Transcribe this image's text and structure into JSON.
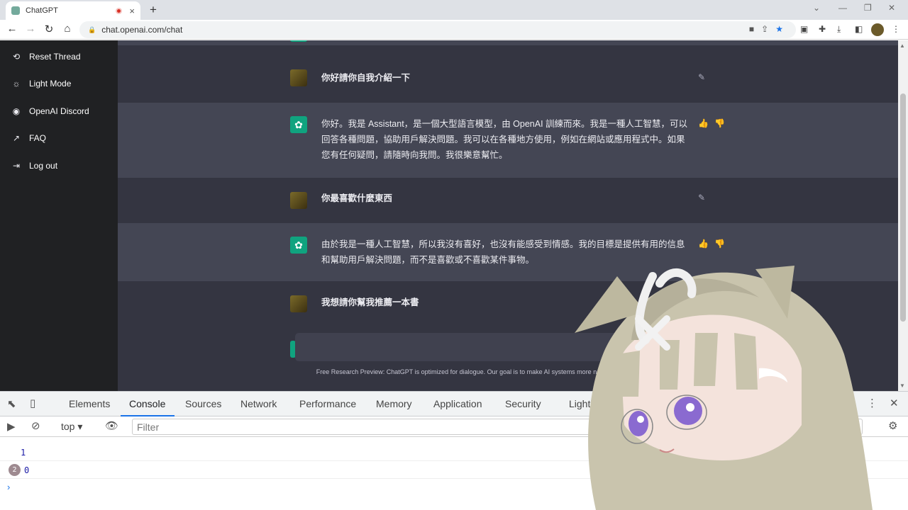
{
  "browser": {
    "tab_title": "ChatGPT",
    "tab_close": "×",
    "new_tab": "+",
    "url": "chat.openai.com/chat"
  },
  "sidebar": {
    "items": [
      {
        "label": "Reset Thread",
        "icon": "refresh-icon"
      },
      {
        "label": "Light Mode",
        "icon": "sun-icon"
      },
      {
        "label": "OpenAI Discord",
        "icon": "discord-icon"
      },
      {
        "label": "FAQ",
        "icon": "external-link-icon"
      },
      {
        "label": "Log out",
        "icon": "logout-icon"
      }
    ]
  },
  "chat": {
    "messages": [
      {
        "role": "user",
        "text": "你好請你自我介紹一下"
      },
      {
        "role": "assistant",
        "text": "你好。我是 Assistant，是一個大型語言模型，由 OpenAI 訓練而來。我是一種人工智慧，可以回答各種問題，協助用戶解決問題。我可以在各種地方使用，例如在網站或應用程式中。如果您有任何疑問，請隨時向我問。我很樂意幫忙。"
      },
      {
        "role": "user",
        "text": "你最喜歡什麼東西"
      },
      {
        "role": "assistant",
        "text": "由於我是一種人工智慧，所以我沒有喜好，也沒有能感受到情感。我的目標是提供有用的信息和幫助用戶解決問題，而不是喜歡或不喜歡某件事物。"
      },
      {
        "role": "user",
        "text": "我想請你幫我推薦一本書"
      }
    ],
    "footnote": "Free Research Preview: ChatGPT is optimized for dialogue. Our goal is to make AI systems more natural to interact with, an                                                     them safer."
  },
  "devtools": {
    "tabs": [
      "Elements",
      "Console",
      "Sources",
      "Network",
      "Performance",
      "Memory",
      "Application",
      "Security",
      "Lighthouse"
    ],
    "active_tab": "Console",
    "issues_count": "1",
    "context": "top",
    "filter_placeholder": "Filter",
    "console_lines": [
      {
        "text": "1",
        "count": ""
      },
      {
        "text": "0",
        "count": "2"
      }
    ],
    "prompt": "›"
  },
  "colors": {
    "sidebar_bg": "#202123",
    "chat_bg": "#343541",
    "bot_bg": "#444654",
    "accent": "#10a37f"
  }
}
